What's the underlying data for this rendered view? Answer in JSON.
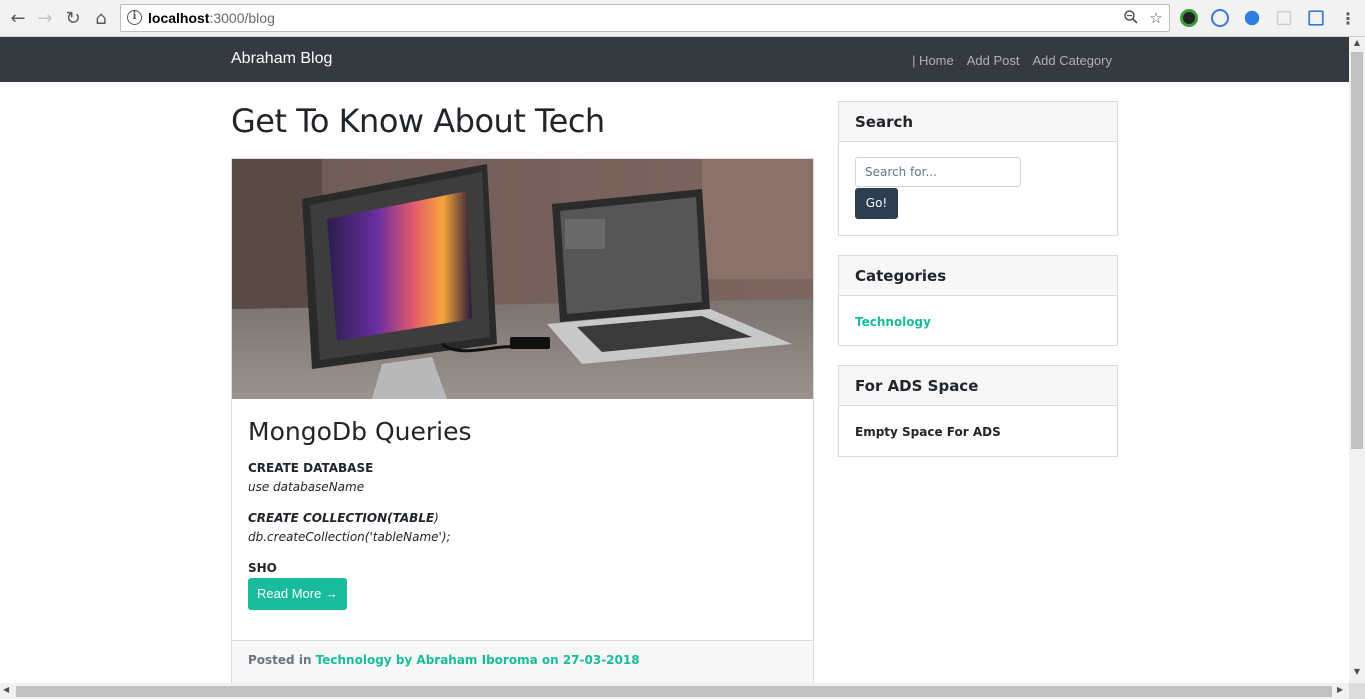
{
  "browser": {
    "url_host": "localhost",
    "url_path": ":3000/blog"
  },
  "navbar": {
    "brand": "Abraham Blog",
    "links": [
      "| Home",
      "Add Post",
      "Add Category"
    ]
  },
  "main": {
    "heading": "Get To Know About Tech",
    "post": {
      "title": "MongoDb Queries",
      "excerpt": {
        "h1": "CREATE DATABASE",
        "c1": "use databaseName",
        "h2": "CREATE COLLECTION(TABLE",
        "h2_tail": ")",
        "c2": "db.createCollection('tableName');",
        "h3": "SHO"
      },
      "read_more": "Read More →",
      "footer": {
        "prefix": "Posted in",
        "category": "Technology",
        "by": "by Abraham Iboroma on 27-03-2018"
      }
    }
  },
  "sidebar": {
    "search": {
      "title": "Search",
      "placeholder": "Search for...",
      "button": "Go!"
    },
    "categories": {
      "title": "Categories",
      "items": [
        "Technology"
      ]
    },
    "ads": {
      "title": "For ADS Space",
      "text": "Empty Space For ADS"
    }
  },
  "colors": {
    "navbar": "#343a40",
    "accent": "#18bc9c",
    "button_dark": "#2c3e50"
  }
}
